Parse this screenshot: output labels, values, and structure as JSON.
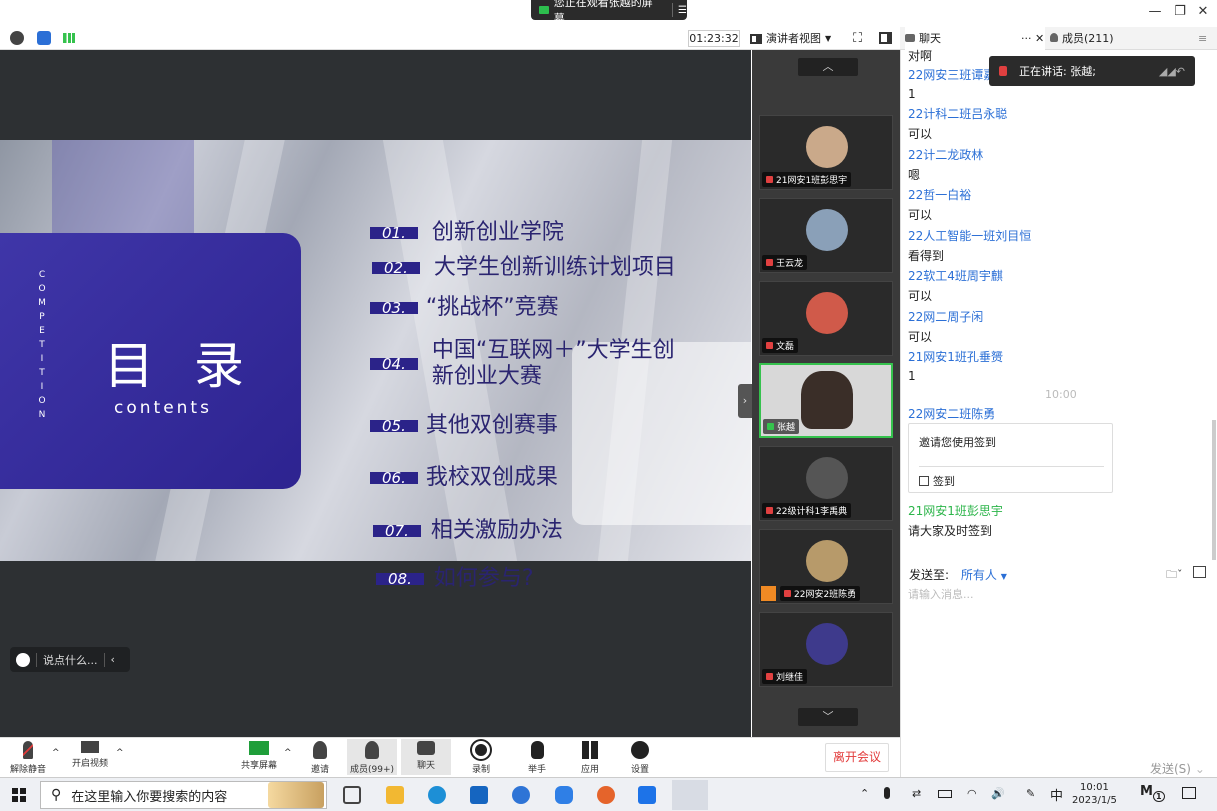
{
  "share_banner": {
    "text": "您正在观看张越的屏幕"
  },
  "meeting_bar": {
    "timer": "01:23:32",
    "view_label": "演讲者视图"
  },
  "slide": {
    "title": "目 录",
    "subtitle": "contents",
    "vertical_text": "COMPETITION",
    "toc": [
      {
        "num": "01.",
        "text": "创新创业学院"
      },
      {
        "num": "02.",
        "text": "大学生创新训练计划项目"
      },
      {
        "num": "03.",
        "text": "“挑战杯”竞赛"
      },
      {
        "num": "04.",
        "text": "中国“互联网＋”大学生创",
        "text2": "新创业大赛"
      },
      {
        "num": "05.",
        "text": "其他双创赛事"
      },
      {
        "num": "06.",
        "text": "我校双创成果"
      },
      {
        "num": "07.",
        "text": "相关激励办法"
      },
      {
        "num": "08.",
        "text": "如何参与?"
      }
    ]
  },
  "comment_box": {
    "placeholder": "说点什么..."
  },
  "videos": [
    {
      "name": "21网安1班彭思宇",
      "avatar_color": "#caa98a"
    },
    {
      "name": "王云龙",
      "avatar_color": "#8aa0b8"
    },
    {
      "name": "文磊",
      "avatar_color": "#d05a4a"
    },
    {
      "name": "张越",
      "avatar_color": "#f0e6dc",
      "active": true
    },
    {
      "name": "22级计科1李禹典",
      "avatar_color": "#444444"
    },
    {
      "name": "22网安2班陈勇",
      "avatar_color": "#b79a6a"
    },
    {
      "name": "刘继佳",
      "avatar_color": "#3e3a8c"
    }
  ],
  "chat_tabs": {
    "chat": "聊天",
    "members": "成员(211)"
  },
  "speaking": {
    "text": "正在讲话: 张越;"
  },
  "chat": {
    "top_partial": "对啊",
    "messages": [
      {
        "name": "22网安三班谭嘉",
        "text": "1"
      },
      {
        "name": "22计科二班吕永聪",
        "text": "可以"
      },
      {
        "name": "22计二龙政林",
        "text": "嗯"
      },
      {
        "name": "22哲一白裕",
        "text": "可以"
      },
      {
        "name": "22人工智能一班刘目恒",
        "text": "看得到"
      },
      {
        "name": "22软工4班周宇麒",
        "text": "可以"
      },
      {
        "name": "22网二周子闲",
        "text": "可以"
      },
      {
        "name": "21网安1班孔垂赟",
        "text": "1"
      }
    ],
    "time_divider": "10:00",
    "sign_sender": "22网安二班陈勇",
    "sign_card_text": "邀请您使用签到",
    "sign_card_action": "签到",
    "last_sender": "21网安1班彭思宇",
    "last_text": "请大家及时签到",
    "send_to_label": "发送至:",
    "send_to_value": "所有人",
    "input_placeholder": "请输入消息...",
    "send_button": "发送(S)"
  },
  "controls": {
    "mute": "解除静音",
    "video": "开启视频",
    "share": "共享屏幕",
    "invite": "邀请",
    "members": "成员(99+)",
    "chat": "聊天",
    "record": "录制",
    "raise_hand": "举手",
    "apps": "应用",
    "settings": "设置",
    "leave": "离开会议"
  },
  "taskbar": {
    "search_placeholder": "在这里输入你要搜索的内容",
    "ime": "中",
    "time": "10:01",
    "date": "2023/1/5",
    "notification_count": "1"
  }
}
